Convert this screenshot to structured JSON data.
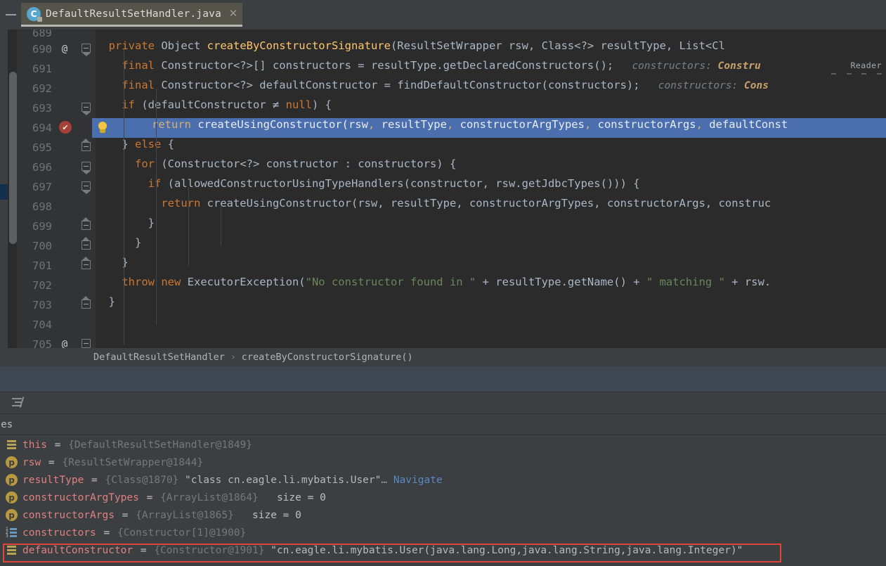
{
  "window": {
    "collapse_icon": "minimize-icon"
  },
  "tab": {
    "filename": "DefaultResultSetHandler.java",
    "icon": "java-class-icon",
    "icon_letter": "C",
    "close_icon": "close-icon"
  },
  "editor": {
    "reader_label": "Reader",
    "lines": [
      {
        "num": "689",
        "clipped": true,
        "tokens": []
      },
      {
        "num": "690",
        "annot": "@",
        "fold": "open",
        "tokens": [
          {
            "t": "kw",
            "v": "  private "
          },
          {
            "t": "id",
            "v": "Object "
          },
          {
            "t": "mth",
            "v": "createByConstructorSignature"
          },
          {
            "t": "pn",
            "v": "("
          },
          {
            "t": "id",
            "v": "ResultSetWrapper rsw"
          },
          {
            "t": "pn",
            "v": ", "
          },
          {
            "t": "id",
            "v": "Class<?> resultType"
          },
          {
            "t": "pn",
            "v": ", "
          },
          {
            "t": "id",
            "v": "List<Cl"
          }
        ]
      },
      {
        "num": "691",
        "tokens": [
          {
            "t": "kw",
            "v": "    final "
          },
          {
            "t": "id",
            "v": "Constructor<?>[] constructors "
          },
          {
            "t": "pn",
            "v": "= "
          },
          {
            "t": "id",
            "v": "resultType.getDeclaredConstructors"
          },
          {
            "t": "pn",
            "v": "();"
          },
          {
            "t": "hint",
            "v": "   constructors: "
          },
          {
            "t": "hintv",
            "v": "Constru"
          }
        ]
      },
      {
        "num": "692",
        "tokens": [
          {
            "t": "kw",
            "v": "    final "
          },
          {
            "t": "id",
            "v": "Constructor<?> defaultConstructor "
          },
          {
            "t": "pn",
            "v": "= "
          },
          {
            "t": "id",
            "v": "findDefaultConstructor"
          },
          {
            "t": "pn",
            "v": "("
          },
          {
            "t": "id",
            "v": "constructors"
          },
          {
            "t": "pn",
            "v": ");"
          },
          {
            "t": "hint",
            "v": "   constructors: "
          },
          {
            "t": "hintv",
            "v": "Cons"
          }
        ]
      },
      {
        "num": "693",
        "fold": "open",
        "tokens": [
          {
            "t": "kw",
            "v": "    if "
          },
          {
            "t": "pn",
            "v": "("
          },
          {
            "t": "id",
            "v": "defaultConstructor "
          },
          {
            "t": "pn",
            "v": "≠ "
          },
          {
            "t": "kw",
            "v": "null"
          },
          {
            "t": "pn",
            "v": ") {"
          }
        ]
      },
      {
        "num": "694",
        "breakpoint": true,
        "bulb": true,
        "selected": true,
        "tokens": [
          {
            "t": "onselp",
            "v": "      return "
          },
          {
            "t": "onsel",
            "v": "createUsingConstructor(rsw"
          },
          {
            "t": "onselp",
            "v": ", "
          },
          {
            "t": "onsel",
            "v": "resultType"
          },
          {
            "t": "onselp",
            "v": ", "
          },
          {
            "t": "onsel",
            "v": "constructorArgTypes"
          },
          {
            "t": "onselp",
            "v": ", "
          },
          {
            "t": "onsel",
            "v": "constructorArgs"
          },
          {
            "t": "onselp",
            "v": ", "
          },
          {
            "t": "onsel",
            "v": "defaultConst"
          }
        ]
      },
      {
        "num": "695",
        "fold": "up",
        "tokens": [
          {
            "t": "pn",
            "v": "    } "
          },
          {
            "t": "kw",
            "v": "else "
          },
          {
            "t": "pn",
            "v": "{"
          }
        ]
      },
      {
        "num": "696",
        "fold": "open",
        "tokens": [
          {
            "t": "kw",
            "v": "      for "
          },
          {
            "t": "pn",
            "v": "("
          },
          {
            "t": "id",
            "v": "Constructor<?> constructor : constructors"
          },
          {
            "t": "pn",
            "v": ") {"
          }
        ]
      },
      {
        "num": "697",
        "fold": "open",
        "tokens": [
          {
            "t": "kw",
            "v": "        if "
          },
          {
            "t": "pn",
            "v": "("
          },
          {
            "t": "id",
            "v": "allowedConstructorUsingTypeHandlers"
          },
          {
            "t": "pn",
            "v": "("
          },
          {
            "t": "id",
            "v": "constructor"
          },
          {
            "t": "pn",
            "v": ", "
          },
          {
            "t": "id",
            "v": "rsw.getJdbcTypes"
          },
          {
            "t": "pn",
            "v": "())) {"
          }
        ]
      },
      {
        "num": "698",
        "tokens": [
          {
            "t": "kw",
            "v": "          return "
          },
          {
            "t": "id",
            "v": "createUsingConstructor(rsw"
          },
          {
            "t": "pn",
            "v": ", "
          },
          {
            "t": "id",
            "v": "resultType"
          },
          {
            "t": "pn",
            "v": ", "
          },
          {
            "t": "id",
            "v": "constructorArgTypes"
          },
          {
            "t": "pn",
            "v": ", "
          },
          {
            "t": "id",
            "v": "constructorArgs"
          },
          {
            "t": "pn",
            "v": ", "
          },
          {
            "t": "id",
            "v": "construc"
          }
        ]
      },
      {
        "num": "699",
        "fold": "up",
        "tokens": [
          {
            "t": "pn",
            "v": "        }"
          }
        ]
      },
      {
        "num": "700",
        "fold": "up",
        "tokens": [
          {
            "t": "pn",
            "v": "      }"
          }
        ]
      },
      {
        "num": "701",
        "fold": "up",
        "tokens": [
          {
            "t": "pn",
            "v": "    }"
          }
        ]
      },
      {
        "num": "702",
        "tokens": [
          {
            "t": "kw",
            "v": "    throw new "
          },
          {
            "t": "id",
            "v": "ExecutorException"
          },
          {
            "t": "pn",
            "v": "("
          },
          {
            "t": "str",
            "v": "\"No constructor found in \" "
          },
          {
            "t": "pn",
            "v": "+ "
          },
          {
            "t": "id",
            "v": "resultType.getName"
          },
          {
            "t": "pn",
            "v": "() + "
          },
          {
            "t": "str",
            "v": "\" matching \" "
          },
          {
            "t": "pn",
            "v": "+ "
          },
          {
            "t": "id",
            "v": "rsw."
          }
        ]
      },
      {
        "num": "703",
        "fold": "up",
        "tokens": [
          {
            "t": "pn",
            "v": "  }"
          }
        ]
      },
      {
        "num": "704",
        "tokens": []
      },
      {
        "num": "705",
        "annot": "@",
        "fold": "open",
        "tokens": []
      }
    ]
  },
  "breadcrumb": {
    "items": [
      "DefaultResultSetHandler",
      "createByConstructorSignature()"
    ],
    "separator": "›"
  },
  "debugger": {
    "toolbar_icon": "settings-sliders-icon",
    "tab_label": "ables",
    "variables": [
      {
        "icon": "object-field-icon",
        "icon_kind": "obj",
        "name": "this",
        "ref": "{DefaultResultSetHandler@1849}",
        "value": "",
        "size": "",
        "nav": ""
      },
      {
        "icon": "parameter-icon",
        "icon_kind": "param",
        "name": "rsw",
        "ref": "{ResultSetWrapper@1844}",
        "value": "",
        "size": "",
        "nav": ""
      },
      {
        "icon": "parameter-icon",
        "icon_kind": "param",
        "name": "resultType",
        "ref": "{Class@1870}",
        "value": "\"class cn.eagle.li.mybatis.User\"",
        "ellipsis": "…",
        "nav": "Navigate",
        "size": ""
      },
      {
        "icon": "parameter-icon",
        "icon_kind": "param",
        "name": "constructorArgTypes",
        "ref": "{ArrayList@1864}",
        "value": "",
        "size": "size = 0",
        "nav": ""
      },
      {
        "icon": "parameter-icon",
        "icon_kind": "param",
        "name": "constructorArgs",
        "ref": "{ArrayList@1865}",
        "value": "",
        "size": "size = 0",
        "nav": ""
      },
      {
        "icon": "array-icon",
        "icon_kind": "arr",
        "name": "constructors",
        "ref": "{Constructor[1]@1900}",
        "value": "",
        "size": "",
        "nav": ""
      },
      {
        "icon": "object-field-icon",
        "icon_kind": "obj",
        "name": "defaultConstructor",
        "ref": "{Constructor@1901}",
        "value": "\"cn.eagle.li.mybatis.User(java.lang.Long,java.lang.String,java.lang.Integer)\"",
        "size": "",
        "nav": "",
        "highlighted": true
      }
    ]
  },
  "colors": {
    "editor_bg": "#2b2b2b",
    "gutter_bg": "#313335",
    "panel_bg": "#3c3f41",
    "selection": "#4b6eaf",
    "keyword": "#cc7832",
    "identifier": "#a9b7c6",
    "method": "#ffc66d",
    "string": "#6a8759",
    "highlight_border": "#e1443b",
    "debug_band": "#3e4652",
    "var_name": "#e08080",
    "nav_link": "#5b87c4"
  }
}
